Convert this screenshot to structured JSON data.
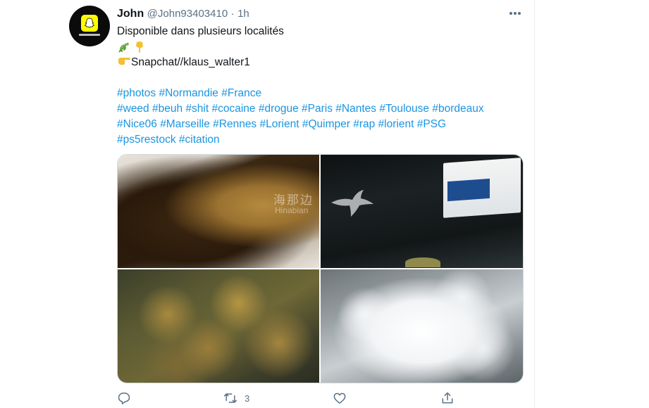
{
  "tweet": {
    "display_name": "John",
    "handle": "@John93403410",
    "separator": "·",
    "time": "1h",
    "text_line_1": "Disponible dans plusieurs localités",
    "emoji_line_2": [
      "herb-emoji",
      "point-down-emoji"
    ],
    "text_line_3_emoji": "point-right-emoji",
    "text_line_3": "Snapchat//klaus_walter1",
    "hashtag_lines": [
      [
        "#photos",
        "#Normandie",
        "#France"
      ],
      [
        "#weed",
        "#beuh",
        "#shit",
        "#cocaine",
        "#drogue",
        "#Paris",
        "#Nantes",
        "#Toulouse",
        "#bordeaux"
      ],
      [
        "#Nice06",
        "#Marseille",
        "#Rennes",
        "#Lorient",
        "#Quimper",
        "#rap",
        "#lorient",
        "#PSG"
      ],
      [
        "#ps5restock",
        "#citation"
      ]
    ]
  },
  "watermark": {
    "text": "海那边",
    "subtext": "Hinabian"
  },
  "actions": {
    "reply_count": "",
    "retweet_count": "3",
    "like_count": "",
    "icons": [
      "reply-icon",
      "retweet-icon",
      "like-icon",
      "share-icon"
    ]
  },
  "colors": {
    "link": "#1b95e0",
    "secondary_text": "#5b7083",
    "primary_text": "#0f1419",
    "snapchat_yellow": "#fffc00"
  }
}
